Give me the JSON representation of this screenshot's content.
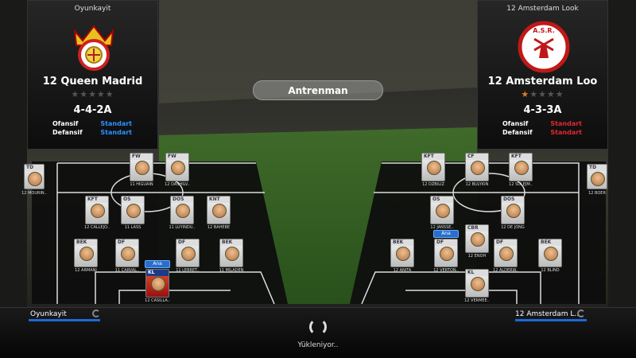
{
  "left_team": {
    "owner": "Oyunkayit",
    "name": "12 Queen Madrid",
    "stars_on": 0,
    "stars_total": 5,
    "formation": "4-4-2A",
    "offense_label": "Ofansif",
    "offense_value": "Standart",
    "defense_label": "Defansif",
    "defense_value": "Standart"
  },
  "right_team": {
    "owner": "12 Amsterdam Look",
    "name": "12 Amsterdam Loo",
    "stars_on": 1,
    "stars_total": 5,
    "formation": "4-3-3A",
    "offense_label": "Ofansif",
    "offense_value": "Standart",
    "defense_label": "Defansif",
    "defense_value": "Standart"
  },
  "center": {
    "mode_label": "Antrenman"
  },
  "left_players": [
    {
      "pos": "FW",
      "label": "11 HIGUAIN"
    },
    {
      "pos": "FW",
      "label": "12 DASHILV.."
    },
    {
      "pos": "KFT",
      "label": "12 CALLEJO.."
    },
    {
      "pos": "OS",
      "label": "11 LASS"
    },
    {
      "pos": "DOS",
      "label": "11 LUYINDU.."
    },
    {
      "pos": "KNT",
      "label": "12 BAHEBE"
    },
    {
      "pos": "BEK",
      "label": "12 ARMANI"
    },
    {
      "pos": "DF",
      "label": "11 CARVAL.."
    },
    {
      "pos": "DF",
      "label": "11 LEBRET.."
    },
    {
      "pos": "BEK",
      "label": "11 MILADEN"
    },
    {
      "pos": "KL",
      "label": "12 CASILLA..",
      "badge": "Ana"
    }
  ],
  "right_players": [
    {
      "pos": "KFT",
      "label": "12 DZBILIZ"
    },
    {
      "pos": "CF",
      "label": "12 BULYKIN"
    },
    {
      "pos": "KFT",
      "label": "12 SULEJM.."
    },
    {
      "pos": "OS",
      "label": "12 JANSSE.."
    },
    {
      "pos": "DOS",
      "label": "12 DE JONG"
    },
    {
      "pos": "BEK",
      "label": "12 ANITA"
    },
    {
      "pos": "DF",
      "label": "12 VERTON..",
      "badge": "Ana"
    },
    {
      "pos": "CBR",
      "label": "12 ENOH"
    },
    {
      "pos": "DF",
      "label": "12 ALDERW.."
    },
    {
      "pos": "BEK",
      "label": "12 BLIND"
    },
    {
      "pos": "KL",
      "label": "12 VERMEE.."
    }
  ],
  "subs_left": {
    "tag": "TD",
    "label": "12 MOURIN.."
  },
  "subs_right": {
    "tag": "TD",
    "label": "12 BOER"
  },
  "bottom": {
    "left_name": "Oyunkayit",
    "right_name": "12 Amsterdam L..",
    "loading": "Yükleniyor.."
  },
  "colors": {
    "standart_blue": "#2a92ff",
    "standart_red": "#e0282e",
    "star_on": "#e67a1e",
    "progress": "#1a6ad8"
  }
}
